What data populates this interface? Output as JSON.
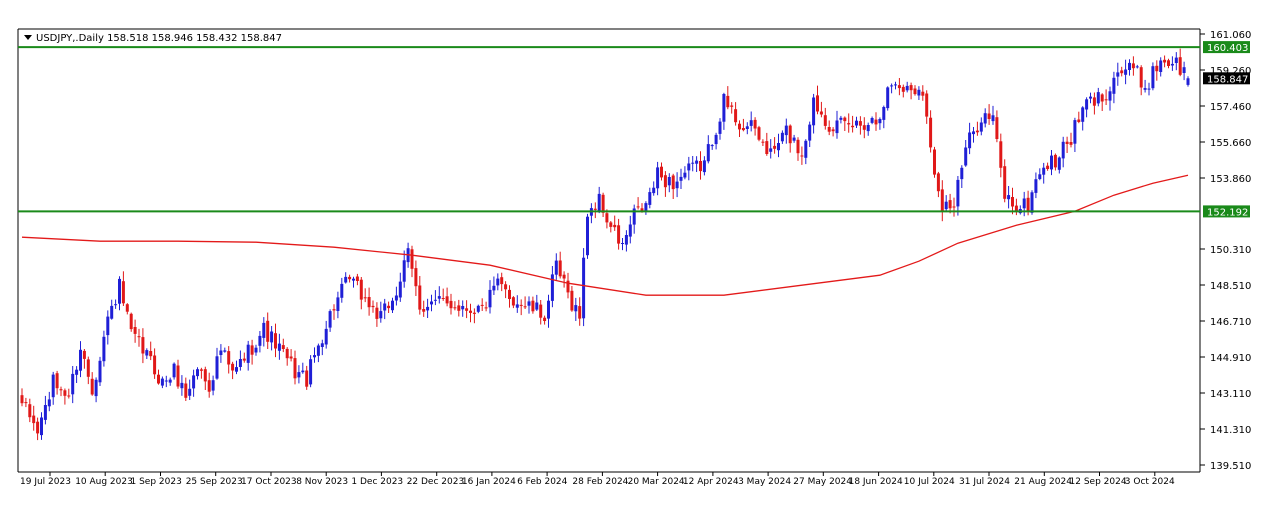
{
  "header": {
    "symbol_line": "USDJPY,.Daily  158.518 158.946 158.432 158.847",
    "dropdown_icon": "triangle-down-icon"
  },
  "price_axis": {
    "labels": [
      "161.060",
      "159.260",
      "157.460",
      "155.660",
      "153.860",
      "150.310",
      "148.510",
      "146.710",
      "144.910",
      "143.110",
      "141.310",
      "139.510"
    ]
  },
  "levels": {
    "upper": {
      "value": 160.403,
      "label": "160.403",
      "color": "#1a8a1a"
    },
    "lower": {
      "value": 152.192,
      "label": "152.192",
      "color": "#1a8a1a"
    },
    "current": {
      "value": 158.847,
      "label": "158.847",
      "color": "#000000"
    }
  },
  "colors": {
    "bull": "#1f1fd6",
    "bear": "#e01818",
    "ma": "#e31a1a",
    "background": "#ffffff",
    "frame": "#000000"
  },
  "chart_data": {
    "type": "candlestick",
    "symbol": "USDJPY",
    "timeframe": "Daily",
    "ylim": [
      139.51,
      161.06
    ],
    "last_bar": {
      "open": 158.518,
      "high": 158.946,
      "low": 158.432,
      "close": 158.847
    },
    "horizontal_lines": [
      160.403,
      152.192
    ],
    "anchor_closes": [
      [
        0,
        142.6
      ],
      [
        4,
        141.2
      ],
      [
        8,
        143.6
      ],
      [
        12,
        143.0
      ],
      [
        15,
        145.4
      ],
      [
        18,
        143.3
      ],
      [
        22,
        146.8
      ],
      [
        25,
        148.4
      ],
      [
        28,
        146.0
      ],
      [
        32,
        145.0
      ],
      [
        36,
        143.6
      ],
      [
        39,
        144.2
      ],
      [
        42,
        143.0
      ],
      [
        45,
        144.4
      ],
      [
        48,
        143.5
      ],
      [
        51,
        145.3
      ],
      [
        54,
        144.0
      ],
      [
        58,
        145.2
      ],
      [
        62,
        146.3
      ],
      [
        66,
        145.3
      ],
      [
        70,
        144.2
      ],
      [
        73,
        143.8
      ],
      [
        76,
        145.5
      ],
      [
        80,
        147.5
      ],
      [
        84,
        148.8
      ],
      [
        88,
        147.8
      ],
      [
        92,
        146.8
      ],
      [
        96,
        148.2
      ],
      [
        99,
        150.0
      ],
      [
        102,
        147.5
      ],
      [
        106,
        147.6
      ],
      [
        110,
        147.6
      ],
      [
        114,
        147.4
      ],
      [
        118,
        147.3
      ],
      [
        122,
        148.5
      ],
      [
        126,
        147.8
      ],
      [
        130,
        147.4
      ],
      [
        134,
        147.0
      ],
      [
        137,
        149.4
      ],
      [
        140,
        148.0
      ],
      [
        143,
        147.0
      ],
      [
        145,
        152.2
      ],
      [
        148,
        152.7
      ],
      [
        151,
        151.4
      ],
      [
        154,
        150.4
      ],
      [
        157,
        152.0
      ],
      [
        160,
        152.5
      ],
      [
        163,
        154.0
      ],
      [
        167,
        153.6
      ],
      [
        171,
        154.2
      ],
      [
        175,
        154.6
      ],
      [
        180,
        157.7
      ],
      [
        184,
        156.6
      ],
      [
        188,
        156.2
      ],
      [
        192,
        155.0
      ],
      [
        196,
        156.2
      ],
      [
        200,
        155.1
      ],
      [
        203,
        157.7
      ],
      [
        207,
        156.6
      ],
      [
        211,
        156.4
      ],
      [
        215,
        156.6
      ],
      [
        219,
        156.8
      ],
      [
        223,
        158.6
      ],
      [
        227,
        158.3
      ],
      [
        231,
        158.4
      ],
      [
        233,
        155.2
      ],
      [
        236,
        152.6
      ],
      [
        239,
        152.5
      ],
      [
        242,
        155.3
      ],
      [
        246,
        157.0
      ],
      [
        249,
        156.8
      ],
      [
        252,
        153.0
      ],
      [
        255,
        152.4
      ],
      [
        258,
        152.5
      ],
      [
        261,
        154.3
      ],
      [
        265,
        154.7
      ],
      [
        269,
        155.9
      ],
      [
        273,
        157.6
      ],
      [
        277,
        157.9
      ],
      [
        281,
        159.2
      ],
      [
        285,
        159.3
      ],
      [
        288,
        158.4
      ],
      [
        292,
        159.8
      ],
      [
        296,
        159.6
      ],
      [
        299,
        158.847
      ]
    ],
    "bars_count": 300,
    "moving_average": {
      "name": "",
      "points": [
        [
          0,
          150.9
        ],
        [
          20,
          150.7
        ],
        [
          40,
          150.7
        ],
        [
          60,
          150.65
        ],
        [
          80,
          150.4
        ],
        [
          100,
          150.0
        ],
        [
          120,
          149.5
        ],
        [
          140,
          148.6
        ],
        [
          160,
          148.0
        ],
        [
          180,
          148.0
        ],
        [
          200,
          148.5
        ],
        [
          220,
          149.0
        ],
        [
          230,
          149.7
        ],
        [
          240,
          150.6
        ],
        [
          255,
          151.5
        ],
        [
          270,
          152.2
        ],
        [
          280,
          153.0
        ],
        [
          290,
          153.6
        ],
        [
          299,
          154.0
        ]
      ]
    },
    "xaxis_labels": [
      "19 Jul 2023",
      "10 Aug 2023",
      "1 Sep 2023",
      "25 Sep 2023",
      "17 Oct 2023",
      "8 Nov 2023",
      "1 Dec 2023",
      "22 Dec 2023",
      "16 Jan 2024",
      "6 Feb 2024",
      "28 Feb 2024",
      "20 Mar 2024",
      "12 Apr 2024",
      "3 May 2024",
      "27 May 2024",
      "18 Jun 2024",
      "10 Jul 2024",
      "31 Jul 2024",
      "21 Aug 2024",
      "12 Sep 2024",
      "3 Oct 2024"
    ],
    "grid": false,
    "legend": "none"
  }
}
